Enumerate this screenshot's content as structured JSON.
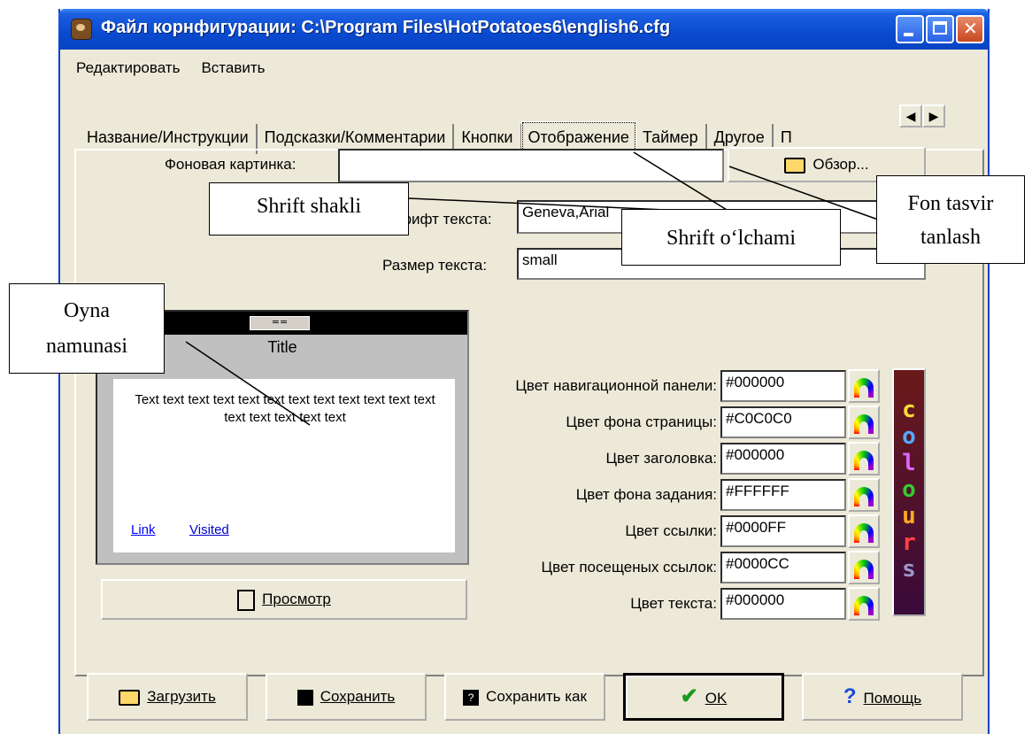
{
  "window": {
    "title": "Файл корнфигурации: C:\\Program Files\\HotPotatoes6\\english6.cfg"
  },
  "menu": [
    "Редактировать",
    "Вставить"
  ],
  "tabs": [
    "Название/Инструкции",
    "Подсказки/Комментарии",
    "Кнопки",
    "Отображение",
    "Таймер",
    "Другое",
    "П"
  ],
  "active_tab": "Отображение",
  "form": {
    "bg_image_label": "Фоновая картинка:",
    "bg_image_value": "",
    "browse_label": "Обзор...",
    "font_label": "Шрифт текста:",
    "font_value": "Geneva,Arial",
    "size_label": "Размер текста:",
    "size_value": "small"
  },
  "preview": {
    "nav_button": "==",
    "title": "Title",
    "text": "Text text text text text text text text text text text text text text text text text",
    "link": "Link",
    "visited": "Visited",
    "preview_button": "Просмотр"
  },
  "colors": [
    {
      "label": "Цвет навигационной панели:",
      "value": "#000000"
    },
    {
      "label": "Цвет фона страницы:",
      "value": "#C0C0C0"
    },
    {
      "label": "Цвет заголовка:",
      "value": "#000000"
    },
    {
      "label": "Цвет фона задания:",
      "value": "#FFFFFF"
    },
    {
      "label": "Цвет ссылки:",
      "value": "#0000FF"
    },
    {
      "label": "Цвет посещеных ссылок:",
      "value": "#0000CC"
    },
    {
      "label": "Цвет текста:",
      "value": "#000000"
    }
  ],
  "colours_logo": [
    "c",
    "o",
    "l",
    "o",
    "u",
    "r",
    "s"
  ],
  "bottom_buttons": {
    "load": "Загрузить",
    "save": "Сохранить",
    "save_as": "Сохранить как",
    "ok": "OK",
    "help": "Помощь"
  },
  "annotations": {
    "font_shape": "Shrift shakli",
    "font_size": "Shrift o‘lchami",
    "bg_select_1": "Fon tasvir",
    "bg_select_2": "tanlash",
    "window_sample_1": "Oyna",
    "window_sample_2": "namunasi"
  }
}
